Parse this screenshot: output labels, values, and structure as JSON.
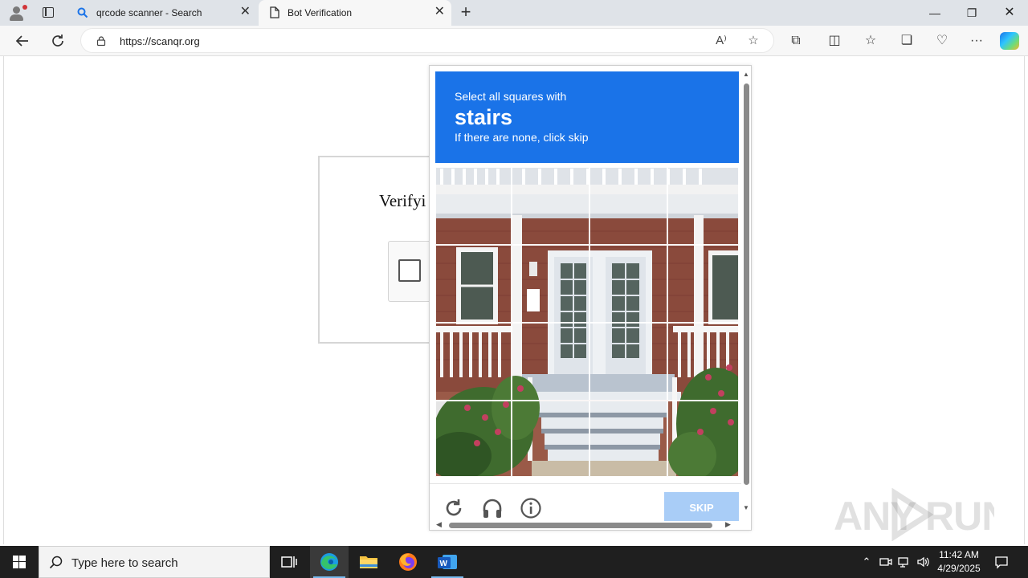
{
  "browser": {
    "tabs": [
      {
        "title": "qrcode scanner - Search",
        "icon": "search-icon"
      },
      {
        "title": "Bot Verification",
        "icon": "page-icon"
      }
    ],
    "address": {
      "url": "https://scanqr.org"
    }
  },
  "page": {
    "verify_title": "Verifyi"
  },
  "challenge": {
    "instruction_line1": "Select all squares with",
    "target": "stairs",
    "instruction_line3": "If there are none, click skip",
    "skip_label": "SKIP",
    "accent_color": "#1a73e8",
    "tile_grid": {
      "rows": 4,
      "columns": 4
    },
    "footer_icons": [
      "reload-icon",
      "audio-icon",
      "info-icon"
    ]
  },
  "watermark": "ANY RUN",
  "taskbar": {
    "search_placeholder": "Type here to search",
    "apps": [
      "task-view-icon",
      "edge-icon",
      "file-explorer-icon",
      "firefox-icon",
      "word-icon"
    ],
    "time": "11:42 AM",
    "date": "4/29/2025"
  }
}
